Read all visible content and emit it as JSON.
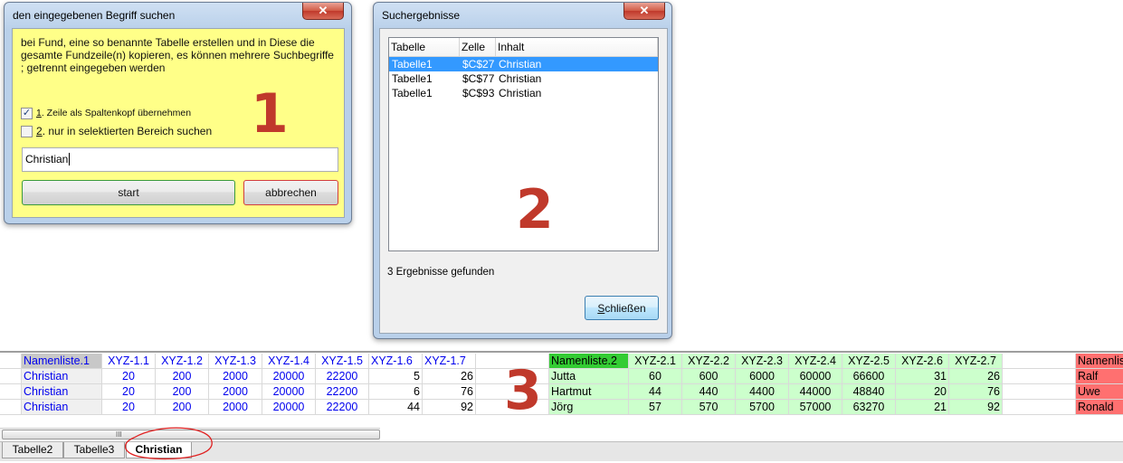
{
  "dialog1": {
    "title": "den eingegebenen Begriff suchen",
    "close": "✕",
    "description": "bei Fund, eine so benannte Tabelle erstellen und in Diese die gesamte Fundzeile(n) kopieren, es können mehrere Suchbegriffe ; getrennt eingegeben werden",
    "checkbox1": {
      "checked": true,
      "mnemonic": "1",
      "rest": ". Zeile als Spaltenkopf übernehmen"
    },
    "checkbox2": {
      "checked": false,
      "mnemonic": "2",
      "rest": ". nur in selektierten Bereich suchen"
    },
    "search_value": "Christian",
    "start_label": "start",
    "cancel_label": "abbrechen",
    "marker": "1"
  },
  "dialog2": {
    "title": "Suchergebnisse",
    "close": "✕",
    "columns": [
      "Tabelle",
      "Zelle",
      "Inhalt"
    ],
    "rows": [
      [
        "Tabelle1",
        "$C$27",
        "Christian"
      ],
      [
        "Tabelle1",
        "$C$77",
        "Christian"
      ],
      [
        "Tabelle1",
        "$C$93",
        "Christian"
      ]
    ],
    "marker": "2",
    "status": "3 Ergebnisse gefunden",
    "close_label": "Schließen"
  },
  "sheet": {
    "marker": "3",
    "headers": [
      "Namenliste.1",
      "XYZ-1.1",
      "XYZ-1.2",
      "XYZ-1.3",
      "XYZ-1.4",
      "XYZ-1.5",
      "XYZ-1.6",
      "XYZ-1.7",
      "Namenliste.2",
      "XYZ-2.1",
      "XYZ-2.2",
      "XYZ-2.3",
      "XYZ-2.4",
      "XYZ-2.5",
      "XYZ-2.6",
      "XYZ-2.7",
      "Namenlis"
    ],
    "rows": [
      [
        "Christian",
        "20",
        "200",
        "2000",
        "20000",
        "22200",
        "5",
        "26",
        "Jutta",
        "60",
        "600",
        "6000",
        "60000",
        "66600",
        "31",
        "26",
        "Ralf"
      ],
      [
        "Christian",
        "20",
        "200",
        "2000",
        "20000",
        "22200",
        "6",
        "76",
        "Hartmut",
        "44",
        "440",
        "4400",
        "44000",
        "48840",
        "20",
        "76",
        "Uwe"
      ],
      [
        "Christian",
        "20",
        "200",
        "2000",
        "20000",
        "22200",
        "44",
        "92",
        "Jörg",
        "57",
        "570",
        "5700",
        "57000",
        "63270",
        "21",
        "92",
        "Ronald"
      ]
    ],
    "tabs": [
      "Tabelle2",
      "Tabelle3",
      "Christian"
    ],
    "active_tab": "Christian",
    "annotation_color": "#e02020"
  }
}
